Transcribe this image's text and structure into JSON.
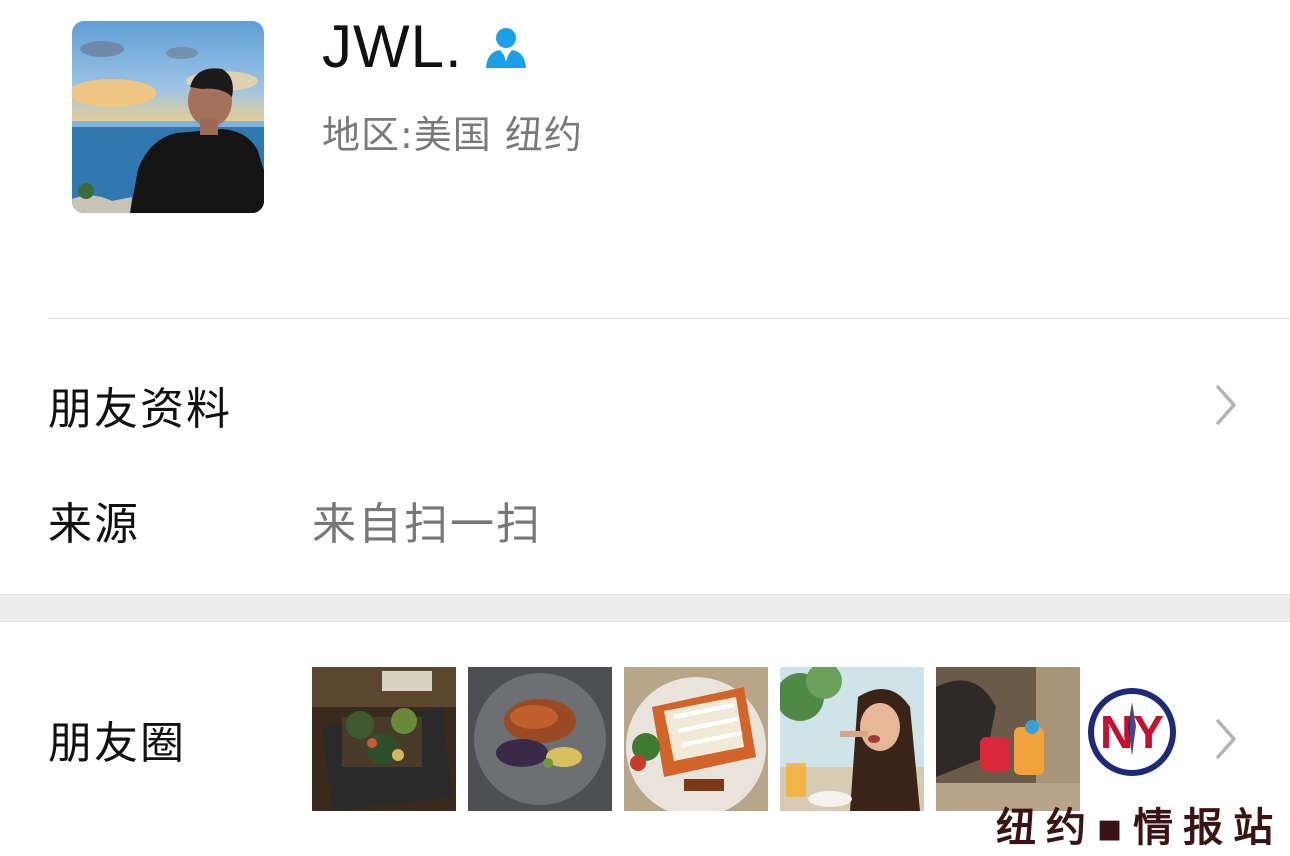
{
  "profile": {
    "name": "JWL.",
    "region": "地区:美国 纽约",
    "avatar_icon": "profile-photo",
    "badge_icon": "user-icon",
    "badge_color": "#1aa0e8"
  },
  "rows": {
    "friend_info": {
      "label": "朋友资料",
      "icon": "chevron-right-icon"
    },
    "source": {
      "label": "来源",
      "value": "来自扫一扫"
    },
    "moments": {
      "label": "朋友圈",
      "icon": "chevron-right-icon",
      "thumbnails": [
        "food-photo-1",
        "food-photo-2",
        "food-photo-3",
        "girl-eating-photo",
        "drinks-photo"
      ]
    }
  },
  "watermark": {
    "text": "纽约▪情报站",
    "logo_letters": "NY",
    "logo_colors": [
      "#c8102e",
      "#1d2a7a"
    ]
  }
}
